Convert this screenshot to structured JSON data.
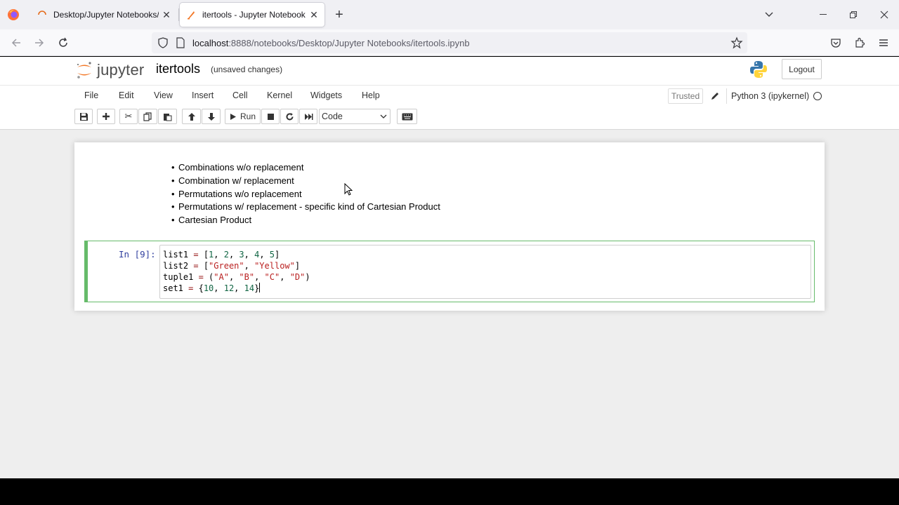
{
  "browser": {
    "tabs": [
      {
        "title": "Desktop/Jupyter Notebooks/",
        "active": false
      },
      {
        "title": "itertools - Jupyter Notebook",
        "active": true
      }
    ],
    "url": {
      "host": "localhost",
      "rest": ":8888/notebooks/Desktop/Jupyter Notebooks/itertools.ipynb"
    }
  },
  "jupyter": {
    "logo_text": "jupyter",
    "notebook_name": "itertools",
    "save_status": "(unsaved changes)",
    "logout_label": "Logout",
    "menu": [
      "File",
      "Edit",
      "View",
      "Insert",
      "Cell",
      "Kernel",
      "Widgets",
      "Help"
    ],
    "trusted_label": "Trusted",
    "kernel_name": "Python 3 (ipykernel)",
    "toolbar": {
      "run_label": "Run",
      "cell_type": "Code"
    }
  },
  "markdown_cell": {
    "items": [
      "Combinations w/o replacement",
      "Combination w/ replacement",
      "Permutations w/o replacement",
      "Permutations w/ replacement - specific kind of Cartesian Product",
      "Cartesian Product"
    ]
  },
  "code_cell": {
    "prompt": "In [9]:",
    "lines": [
      "list1 = [1, 2, 3, 4, 5]",
      "list2 = [\"Green\", \"Yellow\"]",
      "tuple1 = (\"A\", \"B\", \"C\", \"D\")",
      "set1 = {10, 12, 14}"
    ]
  },
  "colors": {
    "selected_cell_border": "#66bb6a",
    "prompt_color": "#303f9f"
  }
}
